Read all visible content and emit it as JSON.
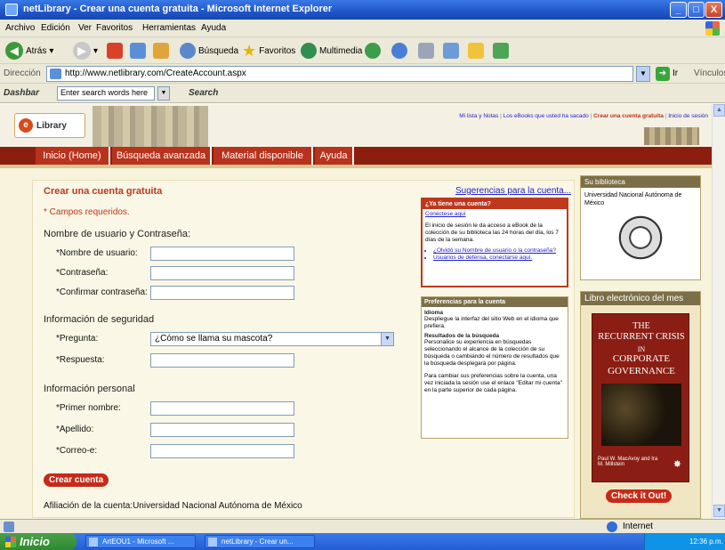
{
  "window": {
    "title": "netLibrary - Crear una cuenta gratuita - Microsoft Internet Explorer",
    "controls": [
      "_",
      "□",
      "X"
    ]
  },
  "menu": [
    "Archivo",
    "Edición",
    "Ver",
    "Favoritos",
    "Herramientas",
    "Ayuda"
  ],
  "toolbar": {
    "back": "Atrás",
    "search": "Búsqueda",
    "favorites": "Favoritos",
    "multimedia": "Multimedia"
  },
  "address": {
    "label": "Dirección",
    "url": "http://www.netlibrary.com/CreateAccount.aspx",
    "go": "Ir",
    "links": "Vínculos"
  },
  "dashbar": {
    "label": "Dashbar",
    "placeholder": "Enter search words here",
    "search": "Search"
  },
  "site": {
    "logo_text": "Library",
    "top_links": {
      "mylist": "Mi lista y Notas",
      "ebooks": "Los eBooks que usted ha sacado",
      "create": "Crear una cuenta gratuita",
      "login": "Inicio de sesión",
      "sep": "|"
    },
    "nav": [
      "Inicio (Home)",
      "Búsqueda avanzada",
      "Material disponible",
      "Ayuda"
    ]
  },
  "form": {
    "title": "Crear una cuenta gratuita",
    "suggestions": "Sugerencias para la cuenta...",
    "required_note": "* Campos requeridos.",
    "section_user": "Nombre de usuario y Contraseña:",
    "username_label": "*Nombre de usuario:",
    "password_label": "*Contraseña:",
    "confirm_label": "*Confirmar contraseña:",
    "section_security": "Información de seguridad",
    "question_label": "*Pregunta:",
    "question_value": "¿Cómo se llama su mascota?",
    "answer_label": "*Respuesta:",
    "section_personal": "Información personal",
    "firstname_label": "*Primer nombre:",
    "lastname_label": "*Apellido:",
    "email_label": "*Correo-e:",
    "create_button": "Crear cuenta",
    "affiliation_label": "Afiliación de la cuenta:",
    "affiliation_value": "Universidad Nacional Autónoma de México"
  },
  "account_box": {
    "title": "¿Ya tiene una cuenta?",
    "link": "Conéctese aquí",
    "text": "El inicio de sesión le da acceso a eBook de la colección de su biblioteca las 24 horas del día, los 7 días de la semana.",
    "forgot": "¿Olvidó su Nombre de usuario o la contraseña?",
    "defense": "Usuarios de defensa, conectarse aquí."
  },
  "prefs_box": {
    "title": "Preferencias para la cuenta",
    "lang_head": "Idioma",
    "lang_text": "Despliegue la interfaz del sitio Web en el idioma que prefiera.",
    "results_head": "Resultados de la búsqueda",
    "results_text": "Personalice su experiencia en búsquedas seleccionando el alcance de la colección de su búsqueda o cambiando el número de resultados que la búsqueda desplegará por página.",
    "change_text": "Para cambiar sus preferencias sobre la cuenta, una vez iniciada la sesión use el enlace \"Editar mi cuenta\" en la parte superior de cada página."
  },
  "library_box": {
    "title": "Su biblioteca",
    "name": "Universidad Nacional Autónoma de México"
  },
  "ebook_box": {
    "title": "Libro electrónico del mes",
    "cover_line1": "THE",
    "cover_line2": "RECURRENT CRISIS",
    "cover_line3": "IN",
    "cover_line4": "CORPORATE",
    "cover_line5": "GOVERNANCE",
    "authors": "Paul W. MacAvoy and Ira M. Millstein",
    "button": "Check it Out!"
  },
  "status": {
    "zone": "Internet"
  },
  "taskbar": {
    "start": "Inicio",
    "tasks": [
      "ArtEOU1 - Microsoft ...",
      "netLibrary - Crear un..."
    ],
    "clock": "12:36 p.m."
  }
}
